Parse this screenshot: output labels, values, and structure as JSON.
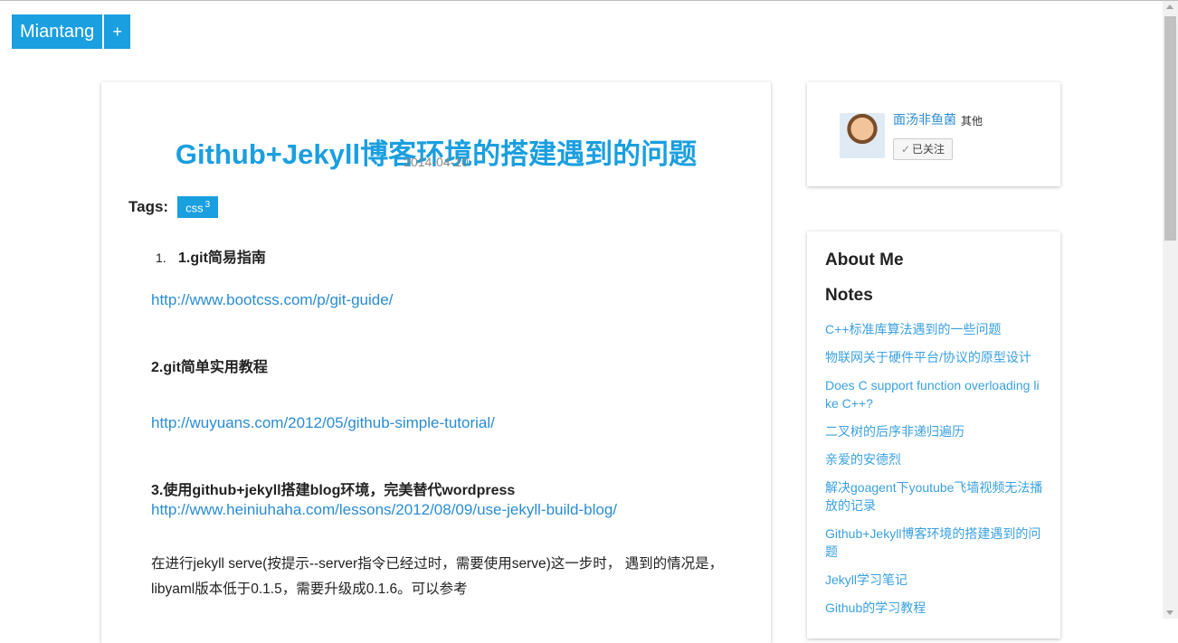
{
  "header": {
    "brand": "Miantang",
    "plus": "+"
  },
  "post": {
    "title": "Github+Jekyll博客环境的搭建遇到的问题",
    "date": "2014-04-10",
    "tags_label": "Tags:",
    "tag": {
      "name": "css",
      "count": "3"
    },
    "item1_num": "1.",
    "item1_title": "1.git简易指南",
    "link1": "http://www.bootcss.com/p/git-guide/",
    "heading2": "2.git简单实用教程",
    "link2": "http://wuyuans.com/2012/05/github-simple-tutorial/",
    "heading3": "3.使用github+jekyll搭建blog环境，完美替代wordpress",
    "link3": "http://www.heiniuhaha.com/lessons/2012/08/09/use-jekyll-build-blog/",
    "para1": "在进行jekyll serve(按提示--server指令已经过时，需要使用serve)这一步时， 遇到的情况是，libyaml版本低于0.1.5，需要升级成0.1.6。可以参考"
  },
  "profile": {
    "name": "面汤非鱼菌",
    "category": "其他",
    "follow_label": "已关注",
    "check": "✓"
  },
  "sidebar": {
    "about": "About Me",
    "notes_title": "Notes",
    "notes": [
      "C++标准库算法遇到的一些问题",
      "物联网关于硬件平台/协议的原型设计",
      "Does C support function overloading like C++?",
      "二叉树的后序非递归遍历",
      "亲爱的安德烈",
      "解决goagent下youtube飞墙视频无法播放的记录",
      "Github+Jekyll博客环境的搭建遇到的问题",
      "Jekyll学习笔记",
      "Github的学习教程"
    ]
  }
}
